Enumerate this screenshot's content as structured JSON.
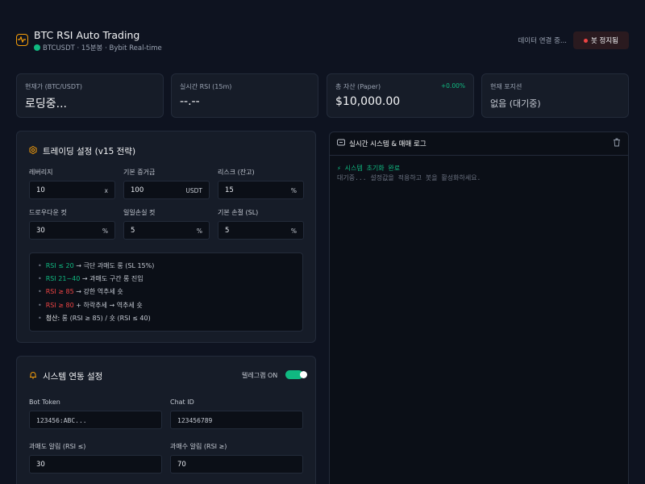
{
  "header": {
    "title": "BTC RSI Auto Trading",
    "subtitle": "BTCUSDT · 15분봉 · Bybit Real-time",
    "connection_status": "데이터 연결 중...",
    "bot_status_button": "봇 정지됨"
  },
  "stats": [
    {
      "label": "현재가 (BTC/USDT)",
      "value": "로딩중..."
    },
    {
      "label": "실시간 RSI (15m)",
      "value": "--.--"
    },
    {
      "label": "총 자산 (Paper)",
      "value": "$10,000.00",
      "change": "+0.00%"
    },
    {
      "label": "현재 포지션",
      "value": "없음 (대기중)"
    }
  ],
  "trading": {
    "title": "트레이딩 설정 (v15 전략)",
    "fields": [
      {
        "label": "레버리지",
        "value": "10",
        "unit": "x"
      },
      {
        "label": "기본 증거금",
        "value": "100",
        "unit": "USDT"
      },
      {
        "label": "리스크 (잔고)",
        "value": "15",
        "unit": "%"
      },
      {
        "label": "드로우다운 컷",
        "value": "30",
        "unit": "%"
      },
      {
        "label": "일일손실 컷",
        "value": "5",
        "unit": "%"
      },
      {
        "label": "기본 손절 (SL)",
        "value": "5",
        "unit": "%"
      }
    ],
    "strategy": [
      {
        "hl": "RSI ≤ 20",
        "rest": " → 극단 과매도 롱 (SL 15%)"
      },
      {
        "hl": "RSI 21~40",
        "rest": " → 과매도 구간 롱 진입"
      },
      {
        "hl": "RSI ≥ 85",
        "rest": " → 강한 역추세 숏"
      },
      {
        "hl": "RSI ≥ 80",
        "rest": " + 하락추세 → 역추세 숏"
      },
      {
        "hl": "청산:",
        "rest": " 롱 (RSI ≥ 85) / 숏 (RSI ≤ 40)"
      }
    ]
  },
  "system": {
    "title": "시스템 연동 설정",
    "toggle_label": "텔레그램 ON",
    "toggle_on": true,
    "fields": [
      {
        "label": "Bot Token",
        "value": "123456:ABC..."
      },
      {
        "label": "Chat ID",
        "value": "123456789"
      },
      {
        "label": "과매도 알림 (RSI ≤)",
        "value": "30"
      },
      {
        "label": "과매수 알림 (RSI ≥)",
        "value": "70"
      }
    ]
  },
  "log": {
    "title": "실시간 시스템 & 매매 로그",
    "lines": [
      "⚡ 시스템 초기화 완료",
      "대기중... 설정값을 적용하고 봇을 활성화하세요."
    ]
  },
  "colors": {
    "background": "#0e1320",
    "card": "#161c28",
    "accent_green": "#10b981",
    "accent_red": "#ef4444",
    "accent_orange": "#f59e0b"
  }
}
